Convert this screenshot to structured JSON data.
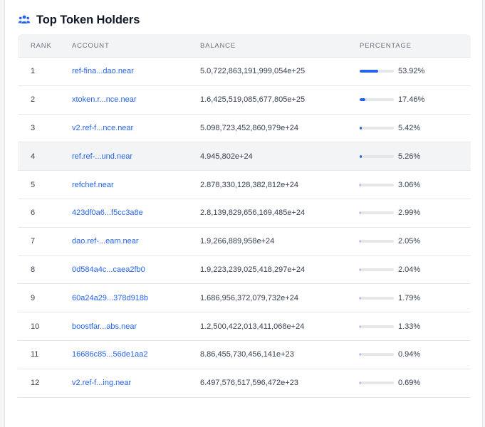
{
  "header": {
    "title": "Top Token Holders",
    "icon": "users-icon"
  },
  "columns": {
    "rank": "RANK",
    "account": "ACCOUNT",
    "balance": "BALANCE",
    "percentage": "PERCENTAGE"
  },
  "accent": "#2563eb",
  "rows": [
    {
      "rank": "1",
      "account": "ref-fina...dao.near",
      "balance": "5.0,722,863,191,999,054e+25",
      "percentage": "53.92%",
      "pct": 53.92
    },
    {
      "rank": "2",
      "account": "xtoken.r...nce.near",
      "balance": "1.6,425,519,085,677,805e+25",
      "percentage": "17.46%",
      "pct": 17.46
    },
    {
      "rank": "3",
      "account": "v2.ref-f...nce.near",
      "balance": "5.098,723,452,860,979e+24",
      "percentage": "5.42%",
      "pct": 5.42
    },
    {
      "rank": "4",
      "account": "ref.ref-...und.near",
      "balance": "4.945,802e+24",
      "percentage": "5.26%",
      "pct": 5.26
    },
    {
      "rank": "5",
      "account": "refchef.near",
      "balance": "2.878,330,128,382,812e+24",
      "percentage": "3.06%",
      "pct": 3.06
    },
    {
      "rank": "6",
      "account": "423df0a6...f5cc3a8e",
      "balance": "2.8,139,829,656,169,485e+24",
      "percentage": "2.99%",
      "pct": 2.99
    },
    {
      "rank": "7",
      "account": "dao.ref-...eam.near",
      "balance": "1.9,266,889,958e+24",
      "percentage": "2.05%",
      "pct": 2.05
    },
    {
      "rank": "8",
      "account": "0d584a4c...caea2fb0",
      "balance": "1.9,223,239,025,418,297e+24",
      "percentage": "2.04%",
      "pct": 2.04
    },
    {
      "rank": "9",
      "account": "60a24a29...378d918b",
      "balance": "1.686,956,372,079,732e+24",
      "percentage": "1.79%",
      "pct": 1.79
    },
    {
      "rank": "10",
      "account": "boostfar...abs.near",
      "balance": "1.2,500,422,013,411,068e+24",
      "percentage": "1.33%",
      "pct": 1.33
    },
    {
      "rank": "11",
      "account": "16686c85...56de1aa2",
      "balance": "8.86,455,730,456,141e+23",
      "percentage": "0.94%",
      "pct": 0.94
    },
    {
      "rank": "12",
      "account": "v2.ref-f...ing.near",
      "balance": "6.497,576,517,596,472e+23",
      "percentage": "0.69%",
      "pct": 0.69
    }
  ]
}
